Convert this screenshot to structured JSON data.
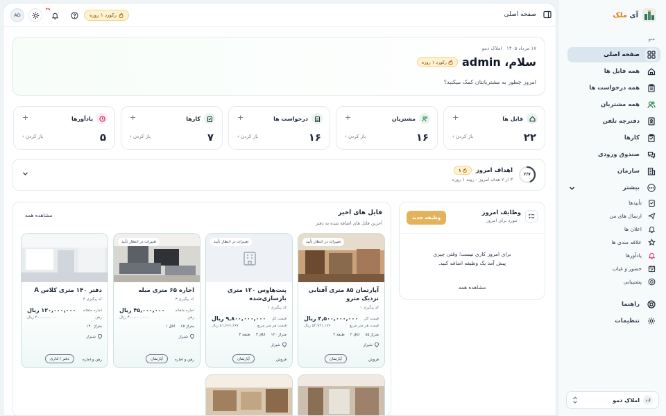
{
  "app": {
    "brand_prefix": "آی",
    "brand_suffix": "ملک"
  },
  "topbar": {
    "avatar_initials": "AD",
    "notification_count": "۴۹",
    "streak_label": "رکورد ۱ روزه",
    "page_title": "صفحه اصلی"
  },
  "hero": {
    "date": "۱۷ مرداد ۱۴۰۵",
    "org": "املاک دمو",
    "greeting": "سلام، admin",
    "streak_label": "رکورد ۱ روزه",
    "subtitle": "امروز چطور به مشتریانتان کمک میکنید؟"
  },
  "stats": [
    {
      "title": "فایل ها",
      "value": "۲۲",
      "open": "باز کردن",
      "plus": "+",
      "icon": "home-icon",
      "color": "#e6f4ec"
    },
    {
      "title": "مشتریان",
      "value": "۱۶",
      "open": "باز کردن",
      "plus": "+",
      "icon": "users-icon",
      "color": "#e6f4ec"
    },
    {
      "title": "درخواست ها",
      "value": "۱۶",
      "open": "باز کردن",
      "plus": "+",
      "icon": "clipboard-icon",
      "color": "#e6f4ec"
    },
    {
      "title": "کارها",
      "value": "۷",
      "open": "باز کردن",
      "plus": "+",
      "icon": "checklist-icon",
      "color": "#e6f4ec"
    },
    {
      "title": "یادآورها",
      "value": "۵",
      "open": "باز کردن",
      "plus": "+",
      "icon": "clock-icon",
      "color": "#fde8ef"
    }
  ],
  "goals": {
    "ring_label": "۳/۷",
    "progress": 0.43,
    "title": "اهداف امروز",
    "badge": "۱",
    "subtitle": "۳ از ۷ هدف امروز - روند ۱ روزه"
  },
  "tasks": {
    "title": "وظایف امروز",
    "subtitle": "۰ مورد برای امروز",
    "new_button": "وظیفه جدید",
    "empty_line1": "برای امروز کاری نیست؛ وقتی چیزی",
    "empty_line2": "پیش آمد یک وظیفه اضافه کنید.",
    "see_all": "مشاهده همه"
  },
  "recent": {
    "title": "فایل های اخیر",
    "subtitle": "آخرین فایل های اضافه شده به دفتر",
    "see_all": "مشاهده همه",
    "cards": [
      {
        "status": "تغییرات در انتظار تأیید",
        "title_l1": "آپارتمان ۸۵ متری آفتابی",
        "title_l2": "نزدیک مترو",
        "code": "کد پیگیری ۱",
        "price": "۴,۵۰۰,۰۰۰,۰۰۰ ریال",
        "price_label": "قیمت کل",
        "sub_price": "۵۲,۹۴۱,۱۷۶ ریال",
        "sub_label": "قیمت هر متر مربع",
        "area": "متراژ ۸۵",
        "rooms": "اتاق ۲",
        "floor": "طبقه ۴",
        "city": "شیراز",
        "deal": "فروش",
        "ptype": "آپارتمان"
      },
      {
        "status": "تغییرات در انتظار تأیید",
        "title_l1": "پنت‌هاوس ۱۲۰ متری",
        "title_l2": "بازسازی‌شده",
        "code": "کد پیگیری ۱",
        "price": "۹,۸۰۰,۰۰۰,۰۰۰ ریال",
        "price_label": "قیمت کل",
        "sub_price": "۸۱,۶۶۶,۶۶۷ ریال",
        "sub_label": "قیمت هر متر مربع",
        "area": "متراژ ۱۲۰",
        "rooms": "اتاق ۳",
        "floor": "طبقه ۳",
        "city": "شیراز",
        "deal": "فروش",
        "ptype": "آپارتمان"
      },
      {
        "status": "تغییرات در انتظار تأیید",
        "title_l1": "اجاره ۶۵ متری مبله",
        "title_l2": "",
        "code": "کد پیگیری ۳",
        "price": "۴۵,۰۰۰,۰۰۰ ریال",
        "price_label": "اجاره ماهانه",
        "sub_price": "۳۰۰,۰۰۰,۰۰۰ ریال",
        "sub_label": "رهن",
        "area": "متراژ ۶۵",
        "rooms": "اتاق ۱",
        "floor": "",
        "city": "شیراز",
        "deal": "رهن و اجاره",
        "ptype": "آپارتمان"
      },
      {
        "status": "",
        "title_l1": "دفتر ۱۴۰ متری کلاس A",
        "title_l2": "",
        "code": "کد پیگیری ۴",
        "price": "۱۲۰,۰۰۰,۰۰۰ ریال",
        "price_label": "اجاره ماهانه",
        "sub_price": "۲۰۰,۰۰۰,۰۰۰ ریال",
        "sub_label": "رهن",
        "area": "متراژ ۱۴۰",
        "rooms": "",
        "floor": "",
        "city": "شیراز",
        "deal": "رهن و اجاره",
        "ptype": "دفتر / اداری"
      }
    ]
  },
  "sidebar": {
    "menu_title": "منو",
    "items": [
      {
        "label": "صفحه اصلی",
        "icon": "dashboard-icon"
      },
      {
        "label": "همه فایل ها",
        "icon": "home-icon"
      },
      {
        "label": "همه درخواست ها",
        "icon": "clipboard-icon"
      },
      {
        "label": "همه مشتریان",
        "icon": "users-icon"
      },
      {
        "label": "دفترچه تلفن",
        "icon": "phonebook-icon"
      },
      {
        "label": "کارها",
        "icon": "checklist-icon"
      },
      {
        "label": "صندوق ورودی",
        "icon": "inbox-icon"
      },
      {
        "label": "سازمان",
        "icon": "building-icon"
      },
      {
        "label": "بیشتر",
        "icon": "more-icon"
      }
    ],
    "sub_items": [
      {
        "label": "تأییدها",
        "icon": "approve-icon"
      },
      {
        "label": "ارسال های من",
        "icon": "send-icon"
      },
      {
        "label": "اعلان ها",
        "icon": "bell-icon"
      },
      {
        "label": "علاقه مندی ها",
        "icon": "star-icon"
      },
      {
        "label": "یادآورها",
        "icon": "alarm-icon"
      },
      {
        "label": "حضور و غیاب",
        "icon": "calendar-icon"
      },
      {
        "label": "پشتیبانی",
        "icon": "support-icon"
      }
    ],
    "bottom_items": [
      {
        "label": "راهنما",
        "icon": "help-icon"
      },
      {
        "label": "تنظیمات",
        "icon": "settings-icon"
      }
    ],
    "org_switch": {
      "label": "املاک دمو",
      "initials": "ا.د"
    }
  }
}
